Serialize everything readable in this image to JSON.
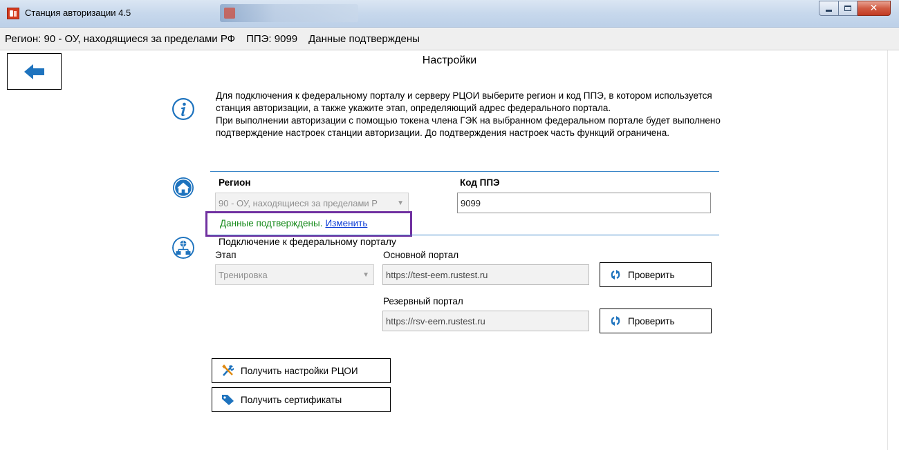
{
  "window": {
    "title": "Станция авторизации 4.5"
  },
  "statusbar": {
    "region": "Регион: 90 - ОУ, находящиеся за пределами РФ",
    "ppe": "ППЭ: 9099",
    "state": "Данные подтверждены"
  },
  "page": {
    "title": "Настройки"
  },
  "info": {
    "text": "Для подключения к федеральному порталу и серверу РЦОИ выберите регион и код ППЭ, в котором используется станция авторизации, а также укажите этап, определяющий адрес федерального портала.\nПри выполнении авторизации с помощью токена члена ГЭК на выбранном федеральном портале будет выполнено подтверждение настроек станции авторизации. До подтверждения настроек часть функций ограничена."
  },
  "region_section": {
    "region_label": "Регион",
    "region_value": "90 - ОУ, находящиеся за пределами Р",
    "ppe_label": "Код ППЭ",
    "ppe_value": "9099",
    "confirm_status": "Данные подтверждены.",
    "confirm_link": "Изменить"
  },
  "portal_section": {
    "heading": "Подключение к федеральному порталу",
    "stage_label": "Этап",
    "stage_value": "Тренировка",
    "main_label": "Основной портал",
    "main_value": "https://test-eem.rustest.ru",
    "reserve_label": "Резервный портал",
    "reserve_value": "https://rsv-eem.rustest.ru",
    "check_label": "Проверить"
  },
  "actions": {
    "get_settings": "Получить настройки РЦОИ",
    "get_certs": "Получить сертификаты"
  },
  "colors": {
    "accent_blue": "#1e73be",
    "confirmed_green": "#168a1a",
    "link_blue": "#0a3bd6",
    "highlight_purple": "#7030a0"
  }
}
